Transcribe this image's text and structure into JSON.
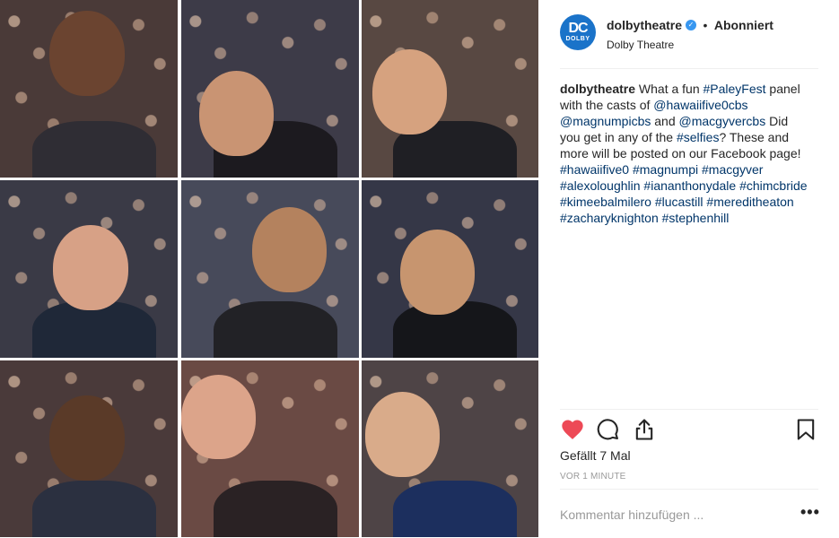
{
  "post": {
    "username": "dolbytheatre",
    "separator": "•",
    "follow_status": "Abonniert",
    "location": "Dolby Theatre",
    "avatar_text": "DC",
    "avatar_brand": "DOLBY",
    "caption": [
      {
        "text": "dolbytheatre",
        "kind": "user"
      },
      {
        "text": " What a fun ",
        "kind": "text"
      },
      {
        "text": "#PaleyFest",
        "kind": "tag"
      },
      {
        "text": " panel with the casts of ",
        "kind": "text"
      },
      {
        "text": "@hawaiifive0cbs",
        "kind": "tag"
      },
      {
        "text": " ",
        "kind": "text"
      },
      {
        "text": "@magnumpicbs",
        "kind": "tag"
      },
      {
        "text": " and ",
        "kind": "text"
      },
      {
        "text": "@macgyvercbs",
        "kind": "tag"
      },
      {
        "text": " Did you get in any of the ",
        "kind": "text"
      },
      {
        "text": "#selfies",
        "kind": "tag"
      },
      {
        "text": "? These and more will be posted on our Facebook page! ",
        "kind": "text"
      },
      {
        "text": "#hawaiifive0",
        "kind": "tag"
      },
      {
        "text": " ",
        "kind": "text"
      },
      {
        "text": "#magnumpi",
        "kind": "tag"
      },
      {
        "text": " ",
        "kind": "text"
      },
      {
        "text": "#macgyver",
        "kind": "tag"
      },
      {
        "text": " ",
        "kind": "text"
      },
      {
        "text": "#alexoloughlin",
        "kind": "tag"
      },
      {
        "text": " ",
        "kind": "text"
      },
      {
        "text": "#iananthonydale",
        "kind": "tag"
      },
      {
        "text": " ",
        "kind": "text"
      },
      {
        "text": "#chimcbride",
        "kind": "tag"
      },
      {
        "text": " ",
        "kind": "text"
      },
      {
        "text": "#kimeebalmilero",
        "kind": "tag"
      },
      {
        "text": " ",
        "kind": "text"
      },
      {
        "text": "#lucastill",
        "kind": "tag"
      },
      {
        "text": " ",
        "kind": "text"
      },
      {
        "text": "#mereditheaton",
        "kind": "tag"
      },
      {
        "text": " ",
        "kind": "text"
      },
      {
        "text": "#zacharyknighton",
        "kind": "tag"
      },
      {
        "text": " ",
        "kind": "text"
      },
      {
        "text": "#stephenhill",
        "kind": "tag"
      }
    ],
    "likes": "Gefällt 7 Mal",
    "time": "VOR 1 MINUTE",
    "comment_placeholder": "Kommentar hinzufügen ...",
    "more_label": "•••"
  },
  "icons": {
    "like": "heart-icon",
    "comment": "comment-icon",
    "share": "share-icon",
    "save": "bookmark-icon",
    "verified": "verified-badge-icon"
  },
  "colors": {
    "heart": "#ed4956",
    "link": "#003569",
    "verified": "#3897f0",
    "avatar": "#1a73c9"
  },
  "collage": {
    "tiles": [
      {
        "bg": "#4a3a38",
        "face": "#6b4430",
        "body": "#2f2d34"
      },
      {
        "bg": "#3d3b48",
        "face": "#c99473",
        "body": "#1c1a1f"
      },
      {
        "bg": "#584842",
        "face": "#d6a27f",
        "body": "#1f1f24"
      },
      {
        "bg": "#3a3a46",
        "face": "#d7a186",
        "body": "#1f2838"
      },
      {
        "bg": "#474a5a",
        "face": "#b4825e",
        "body": "#222226"
      },
      {
        "bg": "#353747",
        "face": "#c7956f",
        "body": "#15161a"
      },
      {
        "bg": "#4a3a3a",
        "face": "#5a3a28",
        "body": "#2b3040"
      },
      {
        "bg": "#6a4a44",
        "face": "#dca48a",
        "body": "#2a2224"
      },
      {
        "bg": "#4e4446",
        "face": "#d9ab8a",
        "body": "#1c2f5e"
      }
    ]
  }
}
